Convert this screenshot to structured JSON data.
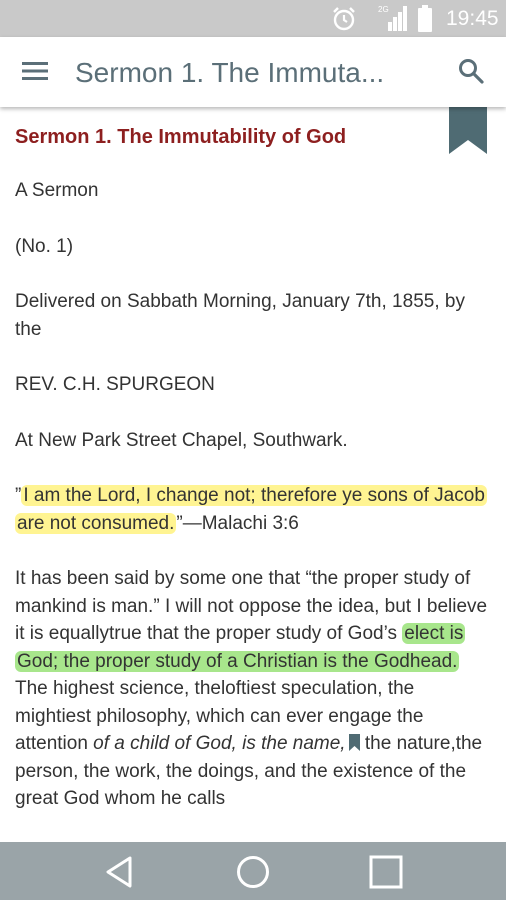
{
  "status_bar": {
    "time": "19:45",
    "network_label": "2G",
    "icons": [
      "alarm-icon",
      "signal-icon",
      "battery-icon"
    ]
  },
  "app_bar": {
    "title": "Sermon 1. The Immuta...",
    "icons": [
      "menu-icon",
      "search-icon"
    ]
  },
  "content": {
    "heading": "Sermon 1. The Immutability of God",
    "lines": {
      "a_sermon": "A Sermon",
      "number": "(No. 1)",
      "delivered": "Delivered on Sabbath Morning, January 7th, 1855, by the",
      "preacher": "REV. C.H. SPURGEON",
      "location": "At New Park Street Chapel, Southwark."
    },
    "quote": {
      "open_mark": "”",
      "highlighted": "I am the Lord, I change not; therefore ye sons of Jacob are not consumed.",
      "close_mark": "”",
      "reference": "—Malachi 3:6"
    },
    "body": {
      "before_highlight": "It has been said by some one that “the proper study of mankind is man.” I will not oppose the idea, but I believe it is equallytrue that the proper study of God’s ",
      "highlighted": "elect is God; the proper study of a Christian is the Godhead.",
      "after_highlight": " The highest science, theloftiest speculation, the mightiest philosophy, which can ever engage the attention ",
      "italic_part": "of a child of God, is the name,",
      "after_bookmark": " the nature,the person, the work, the doings, and the existence of the great God whom he calls"
    },
    "highlight_colors": {
      "yellow": "#fff06e",
      "green": "#87dc5f"
    },
    "accent_color": "#8d1f1f",
    "bookmark_color": "#4f6b73"
  },
  "nav_bar": {
    "buttons": [
      "back-icon",
      "home-icon",
      "recent-apps-icon"
    ]
  }
}
